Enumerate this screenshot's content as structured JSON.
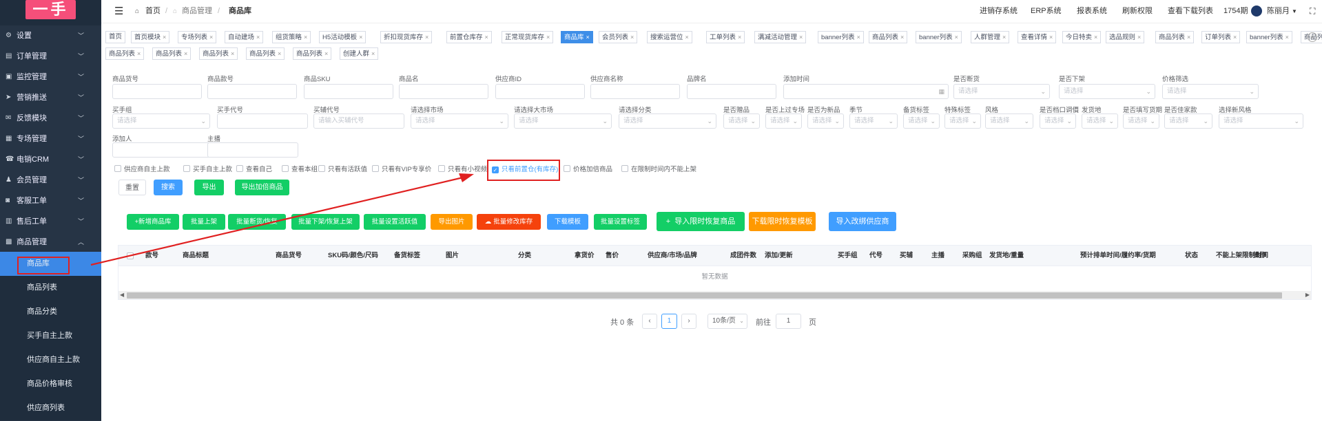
{
  "logo": "一手",
  "sidebar": {
    "menus": [
      {
        "label": "设置",
        "icon": "gear-icon"
      },
      {
        "label": "订单管理",
        "icon": "list-icon"
      },
      {
        "label": "监控管理",
        "icon": "monitor-icon"
      },
      {
        "label": "营销推送",
        "icon": "send-icon"
      },
      {
        "label": "反馈模块",
        "icon": "mail-icon"
      },
      {
        "label": "专场管理",
        "icon": "folder-icon"
      },
      {
        "label": "电销CRM",
        "icon": "phone-icon"
      },
      {
        "label": "会员管理",
        "icon": "user-icon"
      },
      {
        "label": "客服工单",
        "icon": "headset-icon"
      },
      {
        "label": "售后工单",
        "icon": "ticket-icon"
      },
      {
        "label": "商品管理",
        "icon": "box-icon"
      }
    ],
    "subitems": [
      {
        "label": "商品库"
      },
      {
        "label": "商品列表"
      },
      {
        "label": "商品分类"
      },
      {
        "label": "买手自主上款"
      },
      {
        "label": "供应商自主上款"
      },
      {
        "label": "商品价格审核"
      },
      {
        "label": "供应商列表"
      }
    ]
  },
  "header": {
    "breadcrumb": [
      "首页",
      "商品管理",
      "商品库"
    ],
    "links": [
      "进销存系统",
      "ERP系统",
      "报表系统",
      "刷新权限",
      "查看下载列表"
    ],
    "period": "1754期",
    "user": "陈丽月"
  },
  "tags": {
    "row1": [
      "首页",
      "首页模块",
      "专场列表",
      "自动建场",
      "组货策略",
      "H5活动模板",
      "折扣现货库存",
      "前置仓库存",
      "正常现货库存",
      "商品库",
      "会员列表",
      "搜索运营位",
      "工单列表",
      "满减活动管理",
      "banner列表",
      "商品列表",
      "banner列表",
      "人群管理",
      "查看详情",
      "今日特卖",
      "选品规则",
      "商品列表",
      "订单列表",
      "banner列表",
      "商品列表"
    ],
    "row2": [
      "商品列表",
      "商品列表",
      "商品列表",
      "商品列表",
      "商品列表",
      "创建人群"
    ],
    "active": "商品库"
  },
  "filters": {
    "row1": [
      {
        "label": "商品货号",
        "ph": ""
      },
      {
        "label": "商品款号",
        "ph": ""
      },
      {
        "label": "商品SKU",
        "ph": ""
      },
      {
        "label": "商品名",
        "ph": ""
      },
      {
        "label": "供应商ID",
        "ph": ""
      },
      {
        "label": "供应商名称",
        "ph": ""
      },
      {
        "label": "品牌名",
        "ph": ""
      },
      {
        "label": "添加时间",
        "ph": ""
      },
      {
        "label": "是否断货",
        "ph": "请选择"
      },
      {
        "label": "是否下架",
        "ph": "请选择"
      },
      {
        "label": "价格筛选",
        "ph": "请选择"
      }
    ],
    "row2": [
      {
        "label": "买手组",
        "ph": "请选择"
      },
      {
        "label": "买手代号",
        "ph": ""
      },
      {
        "label": "买辅代号",
        "ph": "请输入买辅代号"
      },
      {
        "label": "请选择市场",
        "ph": "请选择"
      },
      {
        "label": "请选择大市场",
        "ph": "请选择"
      },
      {
        "label": "请选择分类",
        "ph": "请选择"
      },
      {
        "label": "是否赠品",
        "ph": "请选择"
      },
      {
        "label": "是否上过专场",
        "ph": "请选择"
      },
      {
        "label": "是否为新品",
        "ph": "请选择"
      },
      {
        "label": "季节",
        "ph": "请选择"
      },
      {
        "label": "备货标签",
        "ph": "请选择"
      },
      {
        "label": "特殊标签",
        "ph": "请选择"
      },
      {
        "label": "风格",
        "ph": "请选择"
      },
      {
        "label": "是否档口调價",
        "ph": "请选择"
      },
      {
        "label": "发货地",
        "ph": "请选择"
      },
      {
        "label": "是否填写货期",
        "ph": "请选择"
      },
      {
        "label": "是否佳家款",
        "ph": "请选择"
      },
      {
        "label": "选择新风格",
        "ph": "请选择"
      }
    ],
    "row3": [
      {
        "label": "添加人",
        "ph": ""
      },
      {
        "label": "主播",
        "ph": ""
      }
    ]
  },
  "checkboxes": [
    {
      "label": "供应商自主上款",
      "checked": false
    },
    {
      "label": "买手自主上款",
      "checked": false
    },
    {
      "label": "查看自己",
      "checked": false
    },
    {
      "label": "查看本组",
      "checked": false
    },
    {
      "label": "只看有活跃值",
      "checked": false
    },
    {
      "label": "只看有VIP专享价",
      "checked": false
    },
    {
      "label": "只看有小视频",
      "checked": false
    },
    {
      "label": "只看前置仓(有库存)",
      "checked": true
    },
    {
      "label": "价格加倍商品",
      "checked": false
    },
    {
      "label": "在限制时间内不能上架",
      "checked": false
    }
  ],
  "search_buttons": [
    "重置",
    "搜索",
    "导出",
    "导出加倍商品"
  ],
  "actions": [
    "+新增商品库",
    "批量上架",
    "批量断货/恢复",
    "批量下架/恢复上架",
    "批量设置活跃值",
    "导出图片",
    "批量修改库存",
    "下载模板",
    "批量设置标签",
    "导入限时恢复商品",
    "下载限时恢复模板",
    "导入改绑供应商"
  ],
  "table": {
    "columns": [
      "款号",
      "商品标题",
      "商品货号",
      "SKU码/颜色/尺码",
      "备货标签",
      "图片",
      "分类",
      "拿货价",
      "售价",
      "供应商/市场/品牌",
      "成团件数",
      "添加/更新",
      "买手组",
      "代号",
      "买辅",
      "主播",
      "采购组",
      "发货地/重量",
      "预计排单时间/履约率/货期",
      "状态",
      "不能上架限制时间",
      "操作"
    ],
    "empty": "暂无数据"
  },
  "pagination": {
    "total": "共 0 条",
    "page": "1",
    "size": "10条/页",
    "goto": "前往",
    "goto_val": "1",
    "unit": "页"
  },
  "colors": {
    "sidebar": "#263445",
    "active": "#3c88e6",
    "highlight": "#e02020",
    "primary": "#409eff",
    "green": "#13ce66"
  }
}
